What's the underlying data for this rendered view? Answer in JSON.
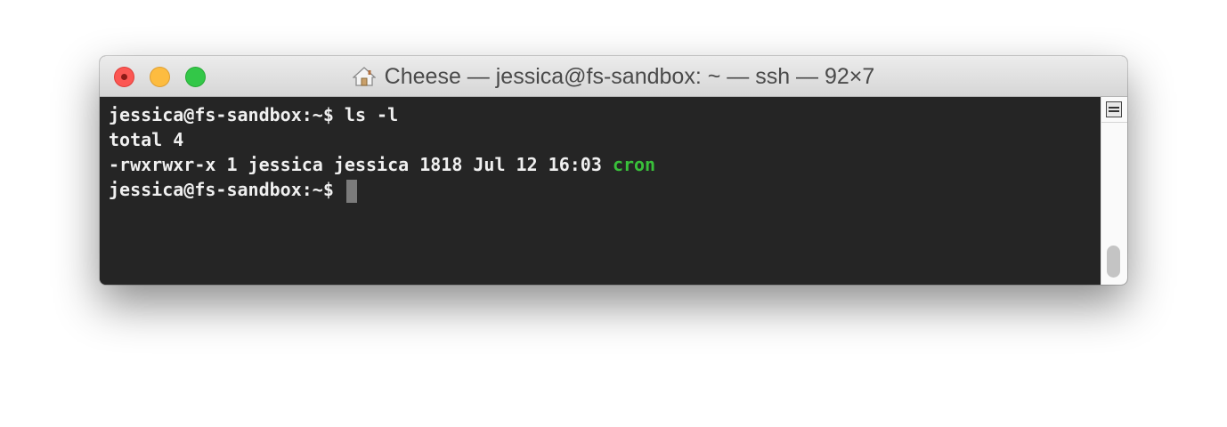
{
  "window": {
    "title": "Cheese — jessica@fs-sandbox: ~ — ssh — 92×7"
  },
  "terminal": {
    "lines": [
      {
        "prompt": "jessica@fs-sandbox:~$ ",
        "command": "ls -l"
      },
      {
        "text": "total 4"
      },
      {
        "text": "-rwxrwxr-x 1 jessica jessica 1818 Jul 12 16:03 ",
        "highlight": "cron"
      },
      {
        "prompt": "jessica@fs-sandbox:~$ "
      }
    ]
  },
  "icons": {
    "title_icon": "home-icon",
    "scrollbar_icon": "split-pane-icon"
  },
  "colors": {
    "background": "#252525",
    "text": "#f0f0f0",
    "executable": "#39c03a",
    "close": "#fc5753",
    "minimize": "#fdbc40",
    "maximize": "#33c748"
  }
}
